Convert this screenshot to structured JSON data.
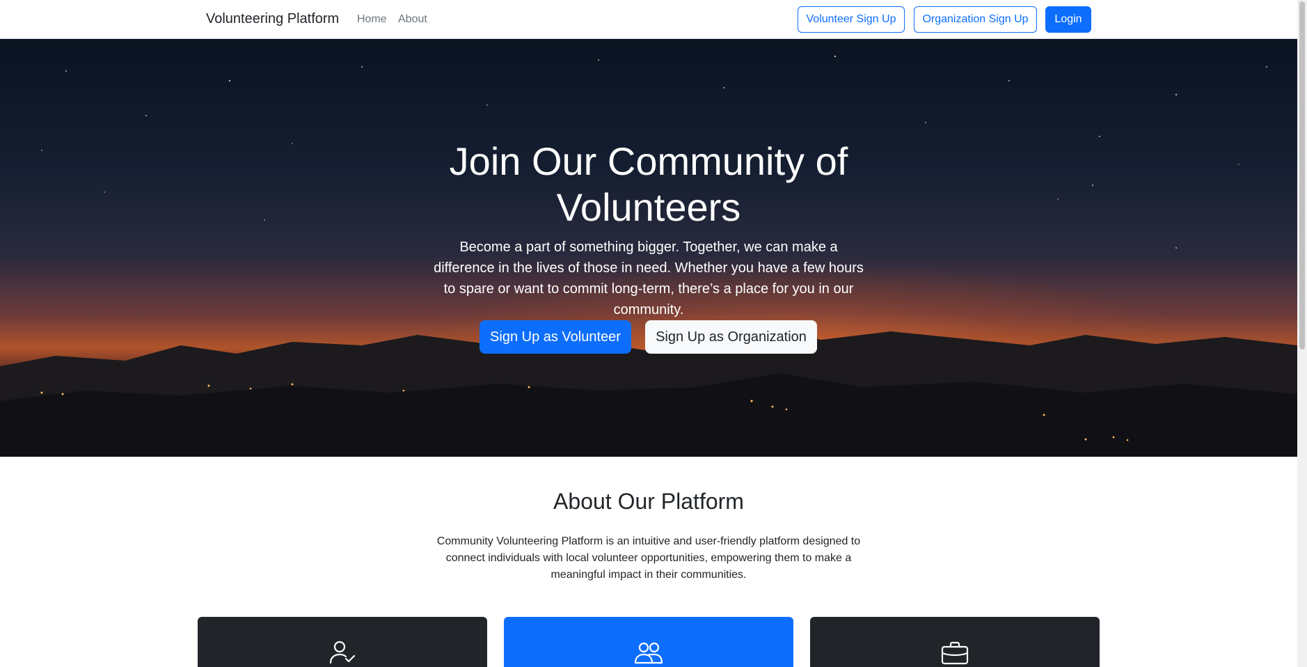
{
  "navbar": {
    "brand": "Volunteering Platform",
    "links": {
      "home": "Home",
      "about": "About"
    },
    "volunteer_signup": "Volunteer Sign Up",
    "organization_signup": "Organization Sign Up",
    "login": "Login"
  },
  "hero": {
    "title": "Join Our Community of Volunteers",
    "text": "Become a part of something bigger. Together, we can make a difference in the lives of those in need. Whether you have a few hours to spare or want to commit long-term, there’s a place for you in our community.",
    "volunteer_button": "Sign Up as Volunteer",
    "organization_button": "Sign Up as Organization"
  },
  "about": {
    "title": "About Our Platform",
    "text": "Community Volunteering Platform is an intuitive and user-friendly platform designed to connect individuals with local volunteer opportunities, empowering them to make a meaningful impact in their communities."
  },
  "cards": [
    {
      "icon": "person-check-icon",
      "color": "#212529"
    },
    {
      "icon": "people-icon",
      "color": "#0d6efd"
    },
    {
      "icon": "briefcase-icon",
      "color": "#212529"
    }
  ],
  "colors": {
    "primary": "#0d6efd",
    "dark": "#212529",
    "light": "#f8f9fa",
    "muted": "#6c757d"
  }
}
